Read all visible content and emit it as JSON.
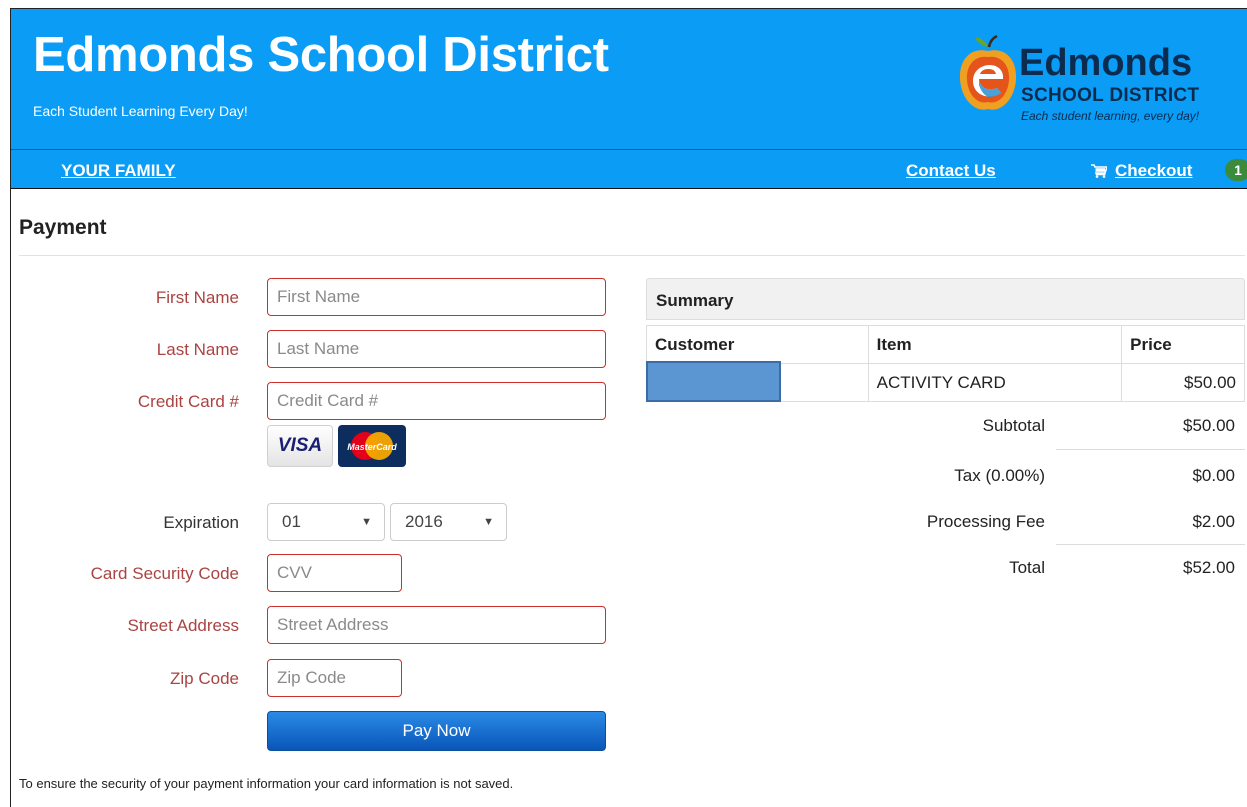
{
  "header": {
    "title": "Edmonds School District",
    "tagline": "Each Student Learning Every Day!",
    "logo": {
      "word": "Edmonds",
      "sub": "SCHOOL DISTRICT",
      "tag": "Each student learning, every day!",
      "brand_colors": {
        "apple": "#f0a020",
        "leaf": "#6aa52a",
        "orange": "#e5541b",
        "navy": "#0b2b4f"
      }
    }
  },
  "nav": {
    "family_label": "YOUR FAMILY",
    "contact_label": "Contact Us",
    "checkout_label": "Checkout",
    "cart_count": "1"
  },
  "page": {
    "heading": "Payment"
  },
  "form": {
    "first_name": {
      "label": "First Name",
      "placeholder": "First Name"
    },
    "last_name": {
      "label": "Last Name",
      "placeholder": "Last Name"
    },
    "card_number": {
      "label": "Credit Card #",
      "placeholder": "Credit Card #"
    },
    "card_brands": {
      "visa": "VISA",
      "mastercard": "MasterCard"
    },
    "expiration": {
      "label": "Expiration",
      "month": "01",
      "year": "2016"
    },
    "cvv": {
      "label": "Card Security Code",
      "placeholder": "CVV"
    },
    "street": {
      "label": "Street Address",
      "placeholder": "Street Address"
    },
    "zip": {
      "label": "Zip Code",
      "placeholder": "Zip Code"
    },
    "submit_label": "Pay Now",
    "security_note": "To ensure the security of your payment information your card information is not saved."
  },
  "summary": {
    "title": "Summary",
    "columns": [
      "Customer",
      "Item",
      "Price"
    ],
    "rows": [
      {
        "customer": "",
        "item": "ACTIVITY CARD",
        "price": "$50.00"
      }
    ],
    "totals": [
      {
        "label": "Subtotal",
        "value": "$50.00"
      },
      {
        "label": "Tax (0.00%)",
        "value": "$0.00"
      },
      {
        "label": "Processing Fee",
        "value": "$2.00"
      },
      {
        "label": "Total",
        "value": "$52.00"
      }
    ]
  },
  "colors": {
    "header_blue": "#0b9cf5",
    "error_red": "#a94442",
    "button_blue": "#0a56b8",
    "badge_green": "#3c8a3c",
    "redaction_blue": "#5b96d3"
  }
}
